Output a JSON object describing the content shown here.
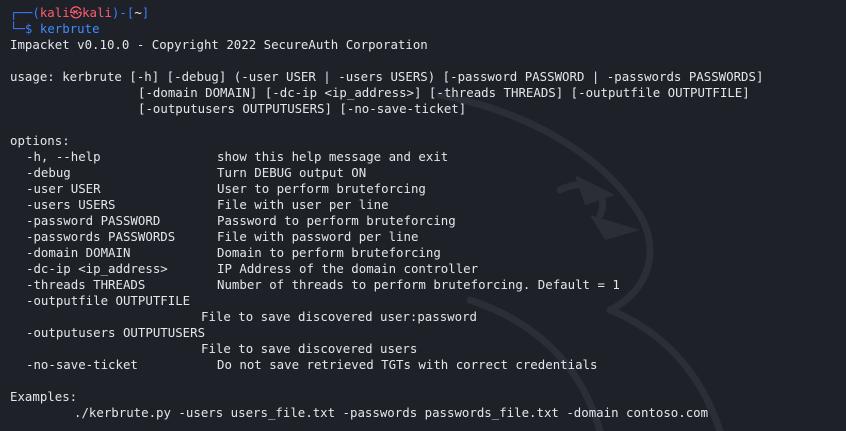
{
  "prompt": {
    "line1_prefix": "┌──(",
    "user": "kali",
    "at": "㉿",
    "host": "kali",
    "mid": ")-[",
    "path": "~",
    "end": "]",
    "line2_prefix": "└─",
    "dollar": "$",
    "command": "kerbrute"
  },
  "header": {
    "version_line": "Impacket v0.10.0 - Copyright 2022 SecureAuth Corporation"
  },
  "usage": {
    "line1": "usage: kerbrute [-h] [-debug] (-user USER | -users USERS) [-password PASSWORD | -passwords PASSWORDS]",
    "line2": "[-domain DOMAIN] [-dc-ip <ip_address>] [-threads THREADS] [-outputfile OUTPUTFILE]",
    "line3": "[-outputusers OUTPUTUSERS] [-no-save-ticket]"
  },
  "options": {
    "heading": "options:",
    "items": [
      {
        "flag": "-h, --help",
        "desc": "show this help message and exit"
      },
      {
        "flag": "-debug",
        "desc": "Turn DEBUG output ON"
      },
      {
        "flag": "-user USER",
        "desc": "User to perform bruteforcing"
      },
      {
        "flag": "-users USERS",
        "desc": "File with user per line"
      },
      {
        "flag": "-password PASSWORD",
        "desc": "Password to perform bruteforcing"
      },
      {
        "flag": "-passwords PASSWORDS",
        "desc": "File with password per line"
      },
      {
        "flag": "-domain DOMAIN",
        "desc": "Domain to perform bruteforcing"
      },
      {
        "flag": "-dc-ip <ip_address>",
        "desc": "IP Address of the domain controller"
      },
      {
        "flag": "-threads THREADS",
        "desc": "Number of threads to perform bruteforcing. Default = 1"
      }
    ],
    "outputfile_flag": "-outputfile OUTPUTFILE",
    "outputfile_desc": "File to save discovered user:password",
    "outputusers_flag": "-outputusers OUTPUTUSERS",
    "outputusers_desc": "File to save discovered users",
    "nosave_flag": "-no-save-ticket",
    "nosave_desc": "Do not save retrieved TGTs with correct credentials"
  },
  "examples": {
    "heading": "Examples:",
    "command": "./kerbrute.py -users users_file.txt -passwords passwords_file.txt -domain contoso.com"
  },
  "colors": {
    "background": "#1e2128",
    "prompt_frame": "#3f7cff",
    "prompt_user": "#ff5c70",
    "text": "#e4e6ea"
  },
  "watermark": {
    "icon": "kali-dragon-watermark-icon"
  }
}
